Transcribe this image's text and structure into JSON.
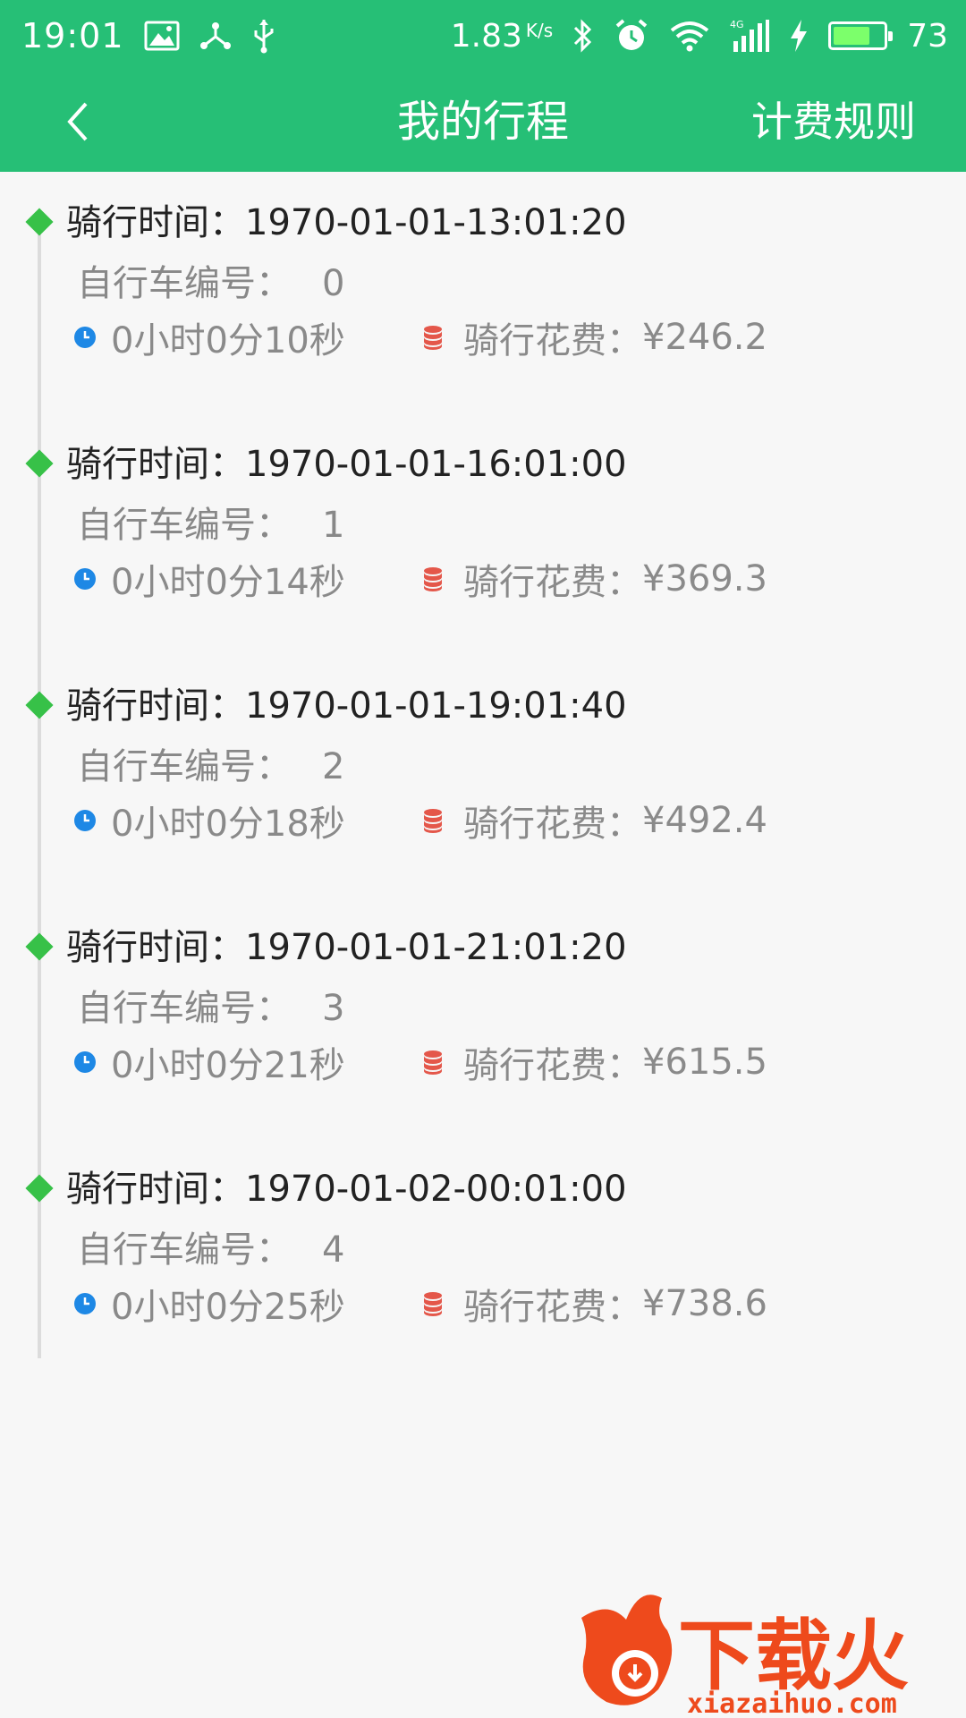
{
  "status_bar": {
    "time": "19:01",
    "net_speed": "1.83",
    "net_unit": "K/s",
    "battery": "73",
    "battery_level": 0.73,
    "icons": [
      "gallery-icon",
      "share-icon",
      "usb-icon",
      "bluetooth-icon",
      "alarm-icon",
      "wifi-icon",
      "signal-icon",
      "charging-icon",
      "battery-icon"
    ]
  },
  "nav": {
    "title": "我的行程",
    "rules": "计费规则",
    "back_icon": "chevron-left-icon"
  },
  "labels": {
    "ride_time": "骑行时间：",
    "bike_no": "自行车编号：",
    "cost": "骑行花费："
  },
  "trips": [
    {
      "time": "1970-01-01-13:01:20",
      "bike": "0",
      "duration": "0小时0分10秒",
      "cost": "¥246.2"
    },
    {
      "time": "1970-01-01-16:01:00",
      "bike": "1",
      "duration": "0小时0分14秒",
      "cost": "¥369.3"
    },
    {
      "time": "1970-01-01-19:01:40",
      "bike": "2",
      "duration": "0小时0分18秒",
      "cost": "¥492.4"
    },
    {
      "time": "1970-01-01-21:01:20",
      "bike": "3",
      "duration": "0小时0分21秒",
      "cost": "¥615.5"
    },
    {
      "time": "1970-01-02-00:01:00",
      "bike": "4",
      "duration": "0小时0分25秒",
      "cost": "¥738.6"
    }
  ],
  "watermark": {
    "brand": "下载火",
    "site": "xiazaihuo.com"
  },
  "colors": {
    "primary": "#26bf76",
    "marker": "#37c148",
    "clock": "#1e88e5",
    "coin": "#e4574a",
    "watermark": "#ee4a1c"
  }
}
